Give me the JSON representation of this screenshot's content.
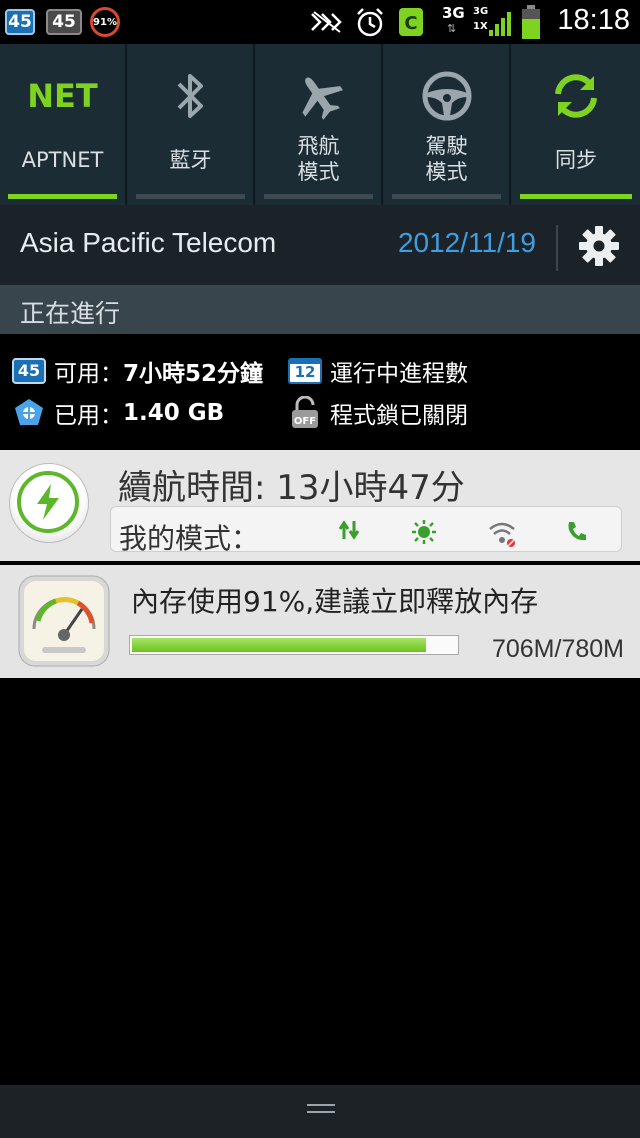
{
  "status_bar": {
    "badge1": "45",
    "badge2": "45",
    "battery_percent_badge": "91%",
    "network_3g": "3G",
    "network_1x": "1X",
    "network_3g_small": "3G",
    "time": "18:18"
  },
  "quick_settings": {
    "toggles": [
      {
        "icon_text": "NET",
        "label": "APTNET",
        "active": true
      },
      {
        "icon": "bluetooth-icon",
        "label": "藍牙",
        "active": false
      },
      {
        "icon": "airplane-icon",
        "label": "飛航\n模式",
        "active": false
      },
      {
        "icon": "steering-wheel-icon",
        "label": "駕駛\n模式",
        "active": false
      },
      {
        "icon": "sync-icon",
        "label": "同步",
        "active": true
      }
    ],
    "active_color": "#7ed321"
  },
  "carrier_row": {
    "carrier": "Asia Pacific Telecom",
    "date": "2012/11/19",
    "date_color": "#3f9ee0"
  },
  "ongoing": {
    "header": "正在進行"
  },
  "info": {
    "available_label": "可用：",
    "available_value": "7小時52分鐘",
    "used_label": "已用：",
    "used_value": "1.40 GB",
    "processes_label": "運行中進程數",
    "processes_badge": "12",
    "lock_label": "程式鎖已關閉",
    "battery_badge": "45"
  },
  "battery_card": {
    "remaining": "續航時間: 13小時47分",
    "mode_label": "我的模式：",
    "mode_icons": [
      "data-arrows-icon",
      "brightness-icon",
      "wifi-off-icon",
      "phone-icon"
    ]
  },
  "memory_card": {
    "message": "內存使用91%,建議立即釋放內存",
    "usage": "706M/780M",
    "usage_fraction": 0.91
  }
}
